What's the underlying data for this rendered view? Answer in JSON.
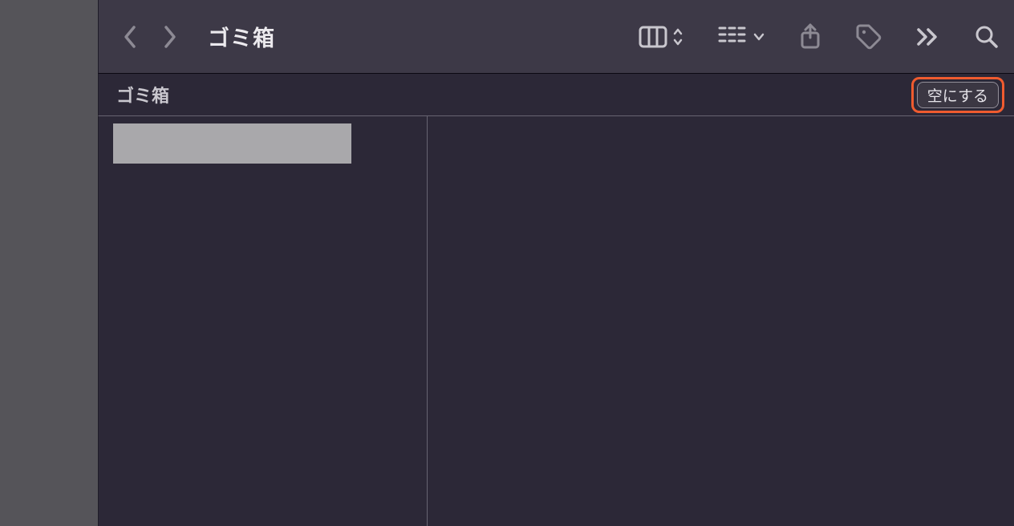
{
  "toolbar": {
    "title": "ゴミ箱"
  },
  "subheader": {
    "title": "ゴミ箱",
    "empty_button": "空にする"
  },
  "content": {
    "items": [
      {
        "label": ""
      }
    ]
  }
}
